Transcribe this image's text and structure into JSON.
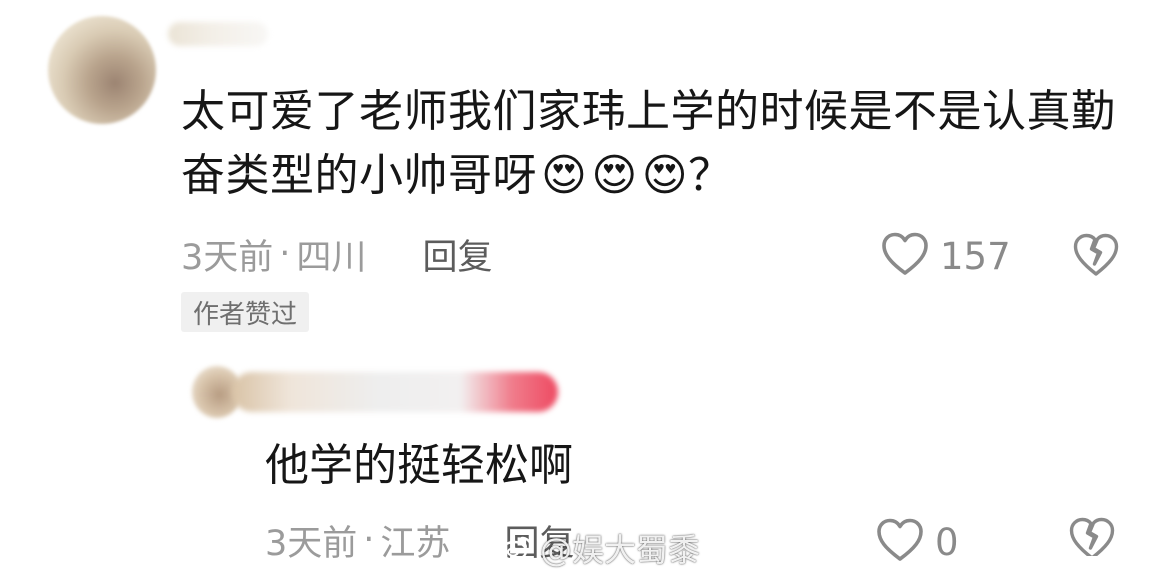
{
  "comment": {
    "text": "太可爱了老师我们家玮上学的时候是不是认真勤奋类型的小帅哥呀",
    "emojis": [
      "😍",
      "😍",
      "😍"
    ],
    "trailing": "？",
    "time": "3天前",
    "separator": "·",
    "location": "四川",
    "reply_label": "回复",
    "like_count": "157",
    "badge": "作者赞过"
  },
  "reply": {
    "text": "他学的挺轻松啊",
    "time": "3天前",
    "separator": "·",
    "location": "江苏",
    "reply_label": "回复",
    "like_count": "0"
  },
  "watermark": {
    "text": "@娱大蜀黍"
  },
  "icons": {
    "like": "heart-outline-icon",
    "dislike": "broken-heart-icon",
    "watermark": "weibo-logo-icon"
  },
  "colors": {
    "text_primary": "#161616",
    "text_secondary": "#9b9b9b",
    "badge_bg": "#f0f0f0"
  }
}
